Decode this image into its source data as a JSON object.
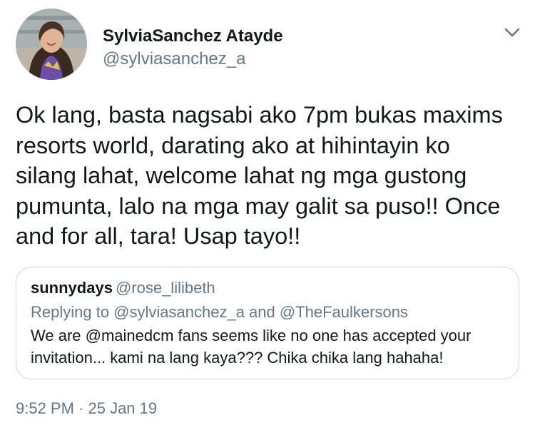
{
  "author": {
    "display_name": "SylviaSanchez Atayde",
    "handle": "@sylviasanchez_a"
  },
  "tweet": {
    "text": "Ok lang, basta nagsabi ako 7pm bukas maxims\nresorts world, darating ako at hihintayin ko\nsilang lahat, welcome lahat ng mga gustong\npumunta, lalo na mga may galit sa puso!! Once\nand for all, tara! Usap tayo!!",
    "timestamp": "9:52 PM · 25 Jan 19"
  },
  "quoted_tweet": {
    "display_name": "sunnydays",
    "handle": "@rose_lilibeth",
    "replying_to": "Replying to @sylviasanchez_a and @TheFaulkersons",
    "text": "We are @mainedcm fans seems like no one has accepted your\ninvitation... kami na lang kaya??? Chika chika lang hahaha!"
  },
  "icons": {
    "menu": "chevron-down-icon",
    "avatar": "avatar-photo"
  },
  "colors": {
    "primary_text": "#14171a",
    "secondary_text": "#657786",
    "border": "#ccd6dd"
  }
}
